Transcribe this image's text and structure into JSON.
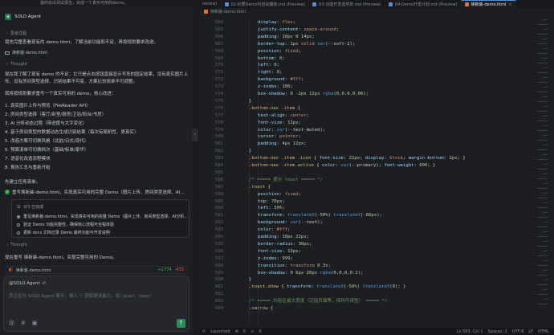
{
  "chat": {
    "top_snippet": "最终给出测试报告，完成一个真实可用的demo。",
    "agent_name": "SOLO Agent",
    "agent_badge": "",
    "thought_label_1": "思考过程",
    "intro": "我先完整查看现有的 demo.html，了解当前功能和不足，再按规划要求改进。",
    "file_chip_1": "焕新装-demo.html",
    "thought_label_2": "Thought",
    "para_1": "现在我了解了现有 demo 的不足：它只是点击按钮直接显示写死的固定结果，没有真实图片上",
    "para_2": "传、没有房间类型选择、识别结果不可变、方案比较简单不可调整。",
    "para_3": "我将按规划要求重写一个真实可用的 demo，核心改进：",
    "features": [
      "1. 真实图片上传与预览（FileReader API）",
      "2. 房间类型选择（客厅/卧室/厨房/卫浴/阳台/书房）",
      "3. AI 分析动态过程（带进度与文字变化）",
      "4. 基于房间类型的数据动态生成识别结果（每次有随机性、更真实）",
      "5. 改造方案可切换风格（北欧/日式/现代）",
      "6. 预算清单可切换档次（基础/标准/豪华）",
      "7. 语音化改造流程模块",
      "8. 报告汇总与重新开始"
    ],
    "start_task": "先建立任务清单。",
    "check_line": "重写焕新装-demo.html，实现真实可用的完整 Demo（图片上传、房间类型选择、AI...",
    "todo": {
      "count": "0/3 已完成",
      "items": [
        "重写焕新装-demo.html，实现真实可用的完整 Demo（图片上传、房间类型选择、AI分析...",
        "验证 Demo 功能完整性，确保核心流程可全程体验",
        "更新 docs 文档记录 Demo 最终功能与开发说明"
      ]
    },
    "thought_label_3": "Thought",
    "rewrite_line": "现在重写 焕新装-demo.html，实现完整可用的 Demo。",
    "diff": {
      "file": "焕新装-demo.html",
      "add": "+1774",
      "del": "-433"
    },
    "input": {
      "mention": "@SOLO Agent",
      "placeholder": "您正在与 SOLO Agent 聊天。输入 '/' 获取更多能力，如 '/plan', '/spec'",
      "send": "↑"
    }
  },
  "editor": {
    "tabs": [
      {
        "label": "review)",
        "active": false
      },
      {
        "label": "02-纪要Demo可自动播放.md (Preview)",
        "active": false
      },
      {
        "label": "03-功能开发选项单.md (Preview)",
        "active": false
      },
      {
        "label": "04-Demo开发计划.md (Preview)",
        "active": false
      },
      {
        "label": "焕新装-demo.html",
        "active": true
      }
    ],
    "breadcrumb": "焕新装-demo.html",
    "code": [
      {
        "ln": "564",
        "html": "<span class='prop'>display</span><span class='pun'>: </span><span class='val'>flex</span><span class='pun'>;</span>",
        "indent": 3
      },
      {
        "ln": "565",
        "html": "<span class='prop'>justify-content</span><span class='pun'>: </span><span class='val'>space-around</span><span class='pun'>;</span>",
        "indent": 3
      },
      {
        "ln": "566",
        "html": "<span class='prop'>padding</span><span class='pun'>: </span><span class='num'>10px 0 14px</span><span class='pun'>;</span>",
        "indent": 3
      },
      {
        "ln": "567",
        "html": "<span class='prop'>border-top</span><span class='pun'>: </span><span class='num'>1px</span> <span class='val'>solid</span> <span class='kw'>var</span><span class='pun'>(--soft-2);</span>",
        "indent": 3
      },
      {
        "ln": "568",
        "html": "<span class='prop'>position</span><span class='pun'>: </span><span class='val'>fixed</span><span class='pun'>;</span>",
        "indent": 3
      },
      {
        "ln": "569",
        "html": "<span class='prop'>bottom</span><span class='pun'>: </span><span class='num'>0</span><span class='pun'>;</span>",
        "indent": 3
      },
      {
        "ln": "570",
        "html": "<span class='prop'>left</span><span class='pun'>: </span><span class='num'>0</span><span class='pun'>;</span>",
        "indent": 3
      },
      {
        "ln": "571",
        "html": "<span class='prop'>right</span><span class='pun'>: </span><span class='num'>0</span><span class='pun'>;</span>",
        "indent": 3
      },
      {
        "ln": "572",
        "html": "<span class='prop'>background</span><span class='pun'>: </span><span class='val'>#fff</span><span class='pun'>;</span>",
        "indent": 3
      },
      {
        "ln": "573",
        "html": "<span class='prop'>z-index</span><span class='pun'>: </span><span class='num'>100</span><span class='pun'>;</span>",
        "indent": 3
      },
      {
        "ln": "574",
        "html": "<span class='prop'>box-shadow</span><span class='pun'>: </span><span class='num'>0 -2px 12px</span> <span class='kw'>rgba</span><span class='pun'>(</span><span class='num'>0,0,0,0.06</span><span class='pun'>);</span>",
        "indent": 3
      },
      {
        "ln": "575",
        "html": "<span class='pun'>}</span>",
        "indent": 2
      },
      {
        "ln": "576",
        "html": "<span class='sel'>.bottom-nav .item</span> <span class='pun'>{</span>",
        "indent": 2
      },
      {
        "ln": "577",
        "html": "<span class='prop'>text-align</span><span class='pun'>: </span><span class='val'>center</span><span class='pun'>;</span>",
        "indent": 3
      },
      {
        "ln": "578",
        "html": "<span class='prop'>font-size</span><span class='pun'>: </span><span class='num'>11px</span><span class='pun'>;</span>",
        "indent": 3
      },
      {
        "ln": "579",
        "html": "<span class='prop'>color</span><span class='pun'>: </span><span class='kw'>var</span><span class='pun'>(--text-muted);</span>",
        "indent": 3
      },
      {
        "ln": "580",
        "html": "<span class='prop'>cursor</span><span class='pun'>: </span><span class='val'>pointer</span><span class='pun'>;</span>",
        "indent": 3
      },
      {
        "ln": "581",
        "html": "<span class='prop'>padding</span><span class='pun'>: </span><span class='num'>4px 12px</span><span class='pun'>;</span>",
        "indent": 3
      },
      {
        "ln": "582",
        "html": "<span class='pun'>}</span>",
        "indent": 2
      },
      {
        "ln": "583",
        "html": "<span class='sel'>.bottom-nav .item .icon</span> <span class='pun'>{ </span><span class='prop'>font-size</span><span class='pun'>: </span><span class='num'>22px</span><span class='pun'>; </span><span class='prop'>display</span><span class='pun'>: </span><span class='val'>block</span><span class='pun'>; </span><span class='prop'>margin-bottom</span><span class='pun'>: </span><span class='num'>2px</span><span class='pun'>; }</span>",
        "indent": 2
      },
      {
        "ln": "584",
        "html": "<span class='sel'>.bottom-nav .item.active</span> <span class='pun'>{ </span><span class='prop'>color</span><span class='pun'>: </span><span class='kw'>var</span><span class='pun'>(--primary); </span><span class='prop'>font-weight</span><span class='pun'>: </span><span class='num'>600</span><span class='pun'>; }</span>",
        "indent": 2
      },
      {
        "ln": "585",
        "html": "",
        "indent": 2
      },
      {
        "ln": "586",
        "html": "<span class='cmt'>/* ===== 提示 toast ===== */</span>",
        "indent": 2
      },
      {
        "ln": "587",
        "html": "<span class='sel'>.toast</span> <span class='pun'>{</span>",
        "indent": 2
      },
      {
        "ln": "588",
        "html": "<span class='prop'>position</span><span class='pun'>: </span><span class='val'>fixed</span><span class='pun'>;</span>",
        "indent": 3
      },
      {
        "ln": "589",
        "html": "<span class='prop'>top</span><span class='pun'>: </span><span class='num'>70px</span><span class='pun'>;</span>",
        "indent": 3
      },
      {
        "ln": "590",
        "html": "<span class='prop'>left</span><span class='pun'>: </span><span class='num'>50%</span><span class='pun'>;</span>",
        "indent": 3
      },
      {
        "ln": "591",
        "html": "<span class='prop'>transform</span><span class='pun'>: </span><span class='kw'>translateX</span><span class='pun'>(</span><span class='num'>-50%</span><span class='pun'>) </span><span class='kw'>translateY</span><span class='pun'>(</span><span class='num'>-80px</span><span class='pun'>);</span>",
        "indent": 3
      },
      {
        "ln": "592",
        "html": "<span class='prop'>background</span><span class='pun'>: </span><span class='kw'>var</span><span class='pun'>(--text);</span>",
        "indent": 3
      },
      {
        "ln": "593",
        "html": "<span class='prop'>color</span><span class='pun'>: </span><span class='val'>#fff</span><span class='pun'>;</span>",
        "indent": 3
      },
      {
        "ln": "594",
        "html": "<span class='prop'>padding</span><span class='pun'>: </span><span class='num'>10px 22px</span><span class='pun'>;</span>",
        "indent": 3
      },
      {
        "ln": "595",
        "html": "<span class='prop'>border-radius</span><span class='pun'>: </span><span class='num'>30px</span><span class='pun'>;</span>",
        "indent": 3
      },
      {
        "ln": "596",
        "html": "<span class='prop'>font-size</span><span class='pun'>: </span><span class='num'>13px</span><span class='pun'>;</span>",
        "indent": 3
      },
      {
        "ln": "597",
        "html": "<span class='prop'>z-index</span><span class='pun'>: </span><span class='num'>999</span><span class='pun'>;</span>",
        "indent": 3
      },
      {
        "ln": "598",
        "html": "<span class='prop'>transition</span><span class='pun'>: </span><span class='val'>transform</span> <span class='num'>0.3s</span><span class='pun'>;</span>",
        "indent": 3
      },
      {
        "ln": "599",
        "html": "<span class='prop'>box-shadow</span><span class='pun'>: </span><span class='num'>0 6px 20px</span> <span class='kw'>rgba</span><span class='pun'>(</span><span class='num'>0,0,0,0.2</span><span class='pun'>);</span>",
        "indent": 3
      },
      {
        "ln": "600",
        "html": "<span class='pun'>}</span>",
        "indent": 2
      },
      {
        "ln": "601",
        "html": "<span class='sel'>.toast.show</span> <span class='pun'>{ </span><span class='prop'>transform</span><span class='pun'>: </span><span class='kw'>translateX</span><span class='pun'>(</span><span class='num'>-50%</span><span class='pun'>) </span><span class='kw'>translateY</span><span class='pun'>(</span><span class='num'>0</span><span class='pun'>); }</span>",
        "indent": 2
      },
      {
        "ln": "602",
        "html": "",
        "indent": 2
      },
      {
        "ln": "603",
        "html": "<span class='cmt'>/* ===== 内容区最大宽度（泛指页面等，保持可读性） ===== */</span>",
        "indent": 2
      },
      {
        "ln": "604",
        "html": "<span class='sel'>.narrow</span> <span class='pun'>{</span>",
        "indent": 2
      }
    ]
  },
  "status": {
    "left": "Launched",
    "errors": "0",
    "warnings": "0",
    "extra": "",
    "right": [
      "Ln 583, Col 1",
      "Spaces: 2",
      "UTF-8",
      "LF",
      "HTML"
    ]
  },
  "colors": {
    "accent": "#4a90e2",
    "send": "#2e8b57",
    "check": "#2ea04f"
  }
}
